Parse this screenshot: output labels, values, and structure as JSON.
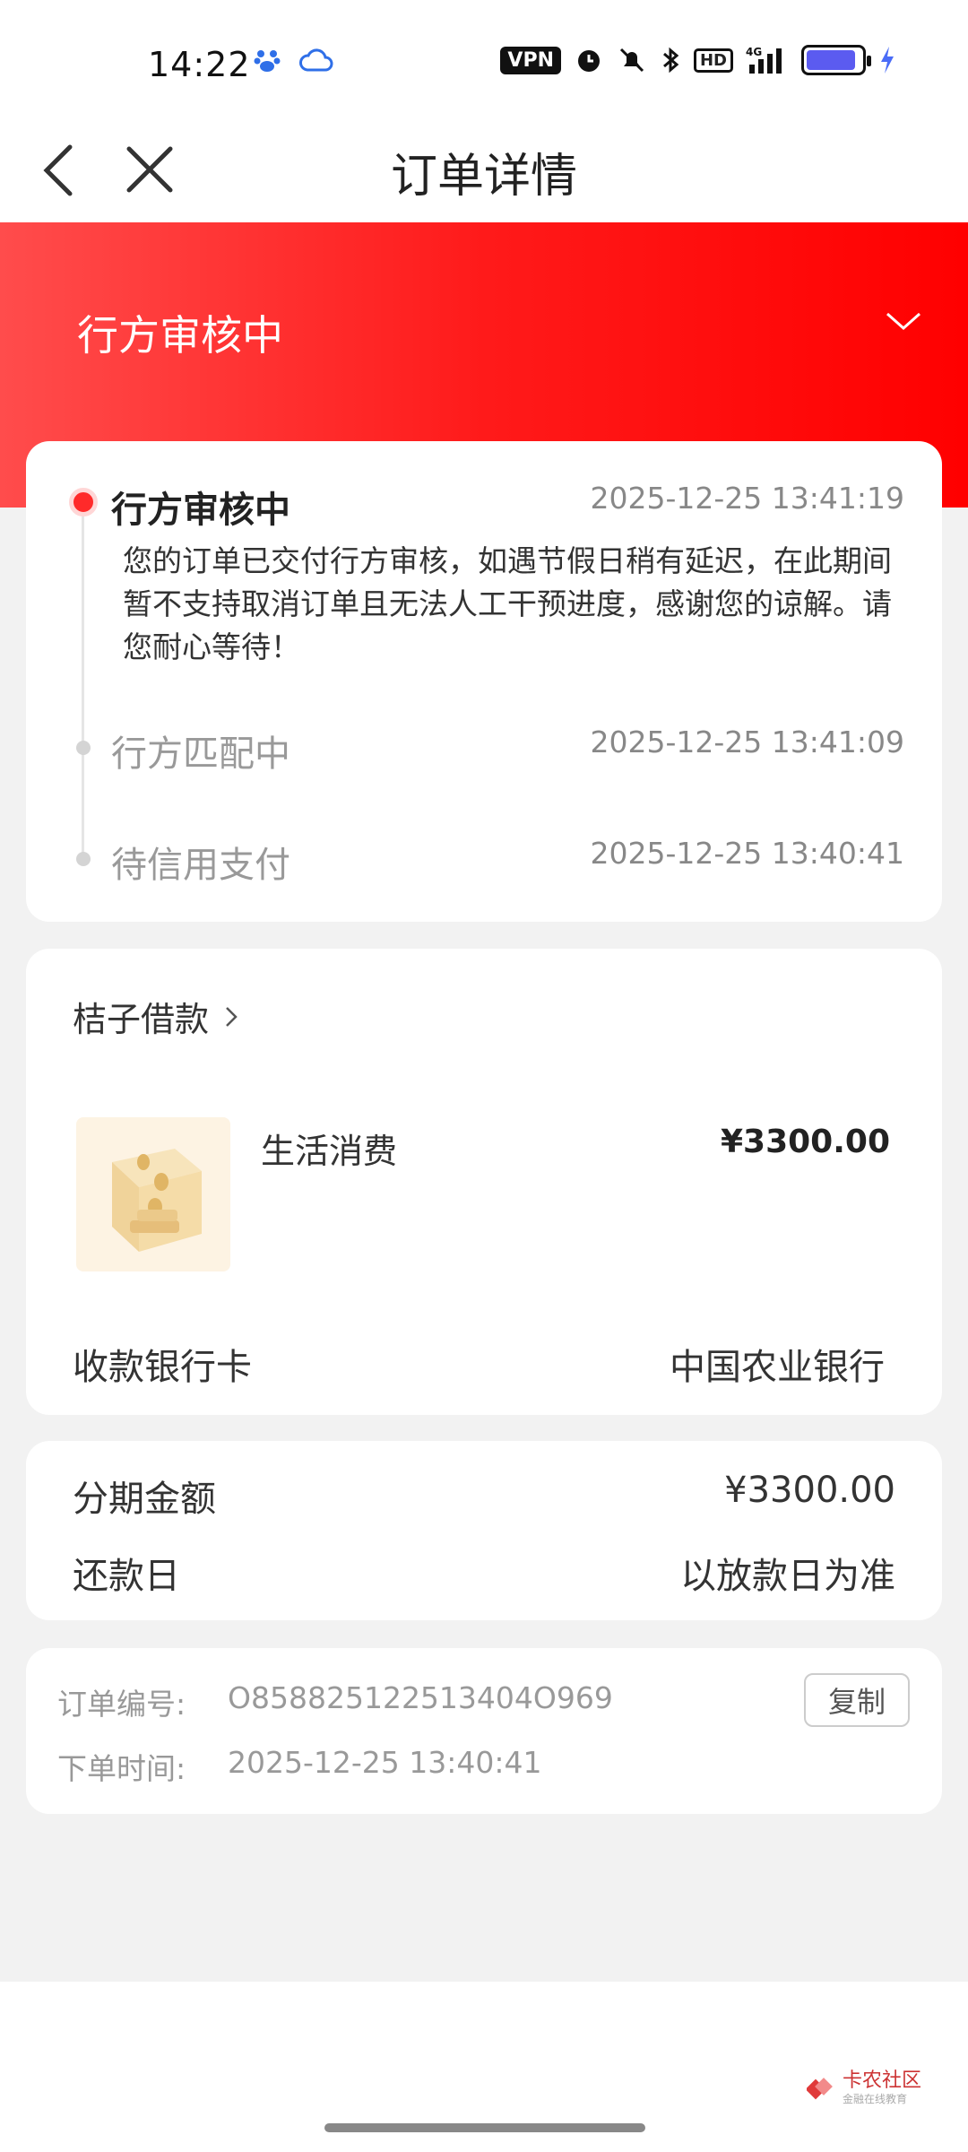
{
  "status_bar": {
    "time": "14:22",
    "vpn": "VPN",
    "hd": "HD",
    "network": "4G",
    "battery_level": 0.9,
    "icons": [
      "baidu-paw-icon",
      "weather-cloud-icon",
      "alarm-icon",
      "mute-bell-icon",
      "bluetooth-icon",
      "signal-icon",
      "charging-icon"
    ]
  },
  "nav": {
    "title": "订单详情"
  },
  "status_header": {
    "title": "行方审核中"
  },
  "timeline": [
    {
      "title": "行方审核中",
      "time": "2025-12-25 13:41:19",
      "description": "您的订单已交付行方审核，如遇节假日稍有延迟，在此期间暂不支持取消订单且无法人工干预进度，感谢您的谅解。请您耐心等待！"
    },
    {
      "title": "行方匹配中",
      "time": "2025-12-25 13:41:09"
    },
    {
      "title": "待信用支付",
      "time": "2025-12-25 13:40:41"
    }
  ],
  "product": {
    "vendor": "桔子借款",
    "name": "生活消费",
    "price": "¥3300.00",
    "bank_label": "收款银行卡",
    "bank_value": "中国农业银行"
  },
  "installment": {
    "amount_label": "分期金额",
    "amount_value": "¥3300.00",
    "repay_label": "还款日",
    "repay_value": "以放款日为准"
  },
  "order_info": {
    "number_label": "订单编号:",
    "number_value": "O858825122513404O969",
    "time_label": "下单时间:",
    "time_value": "2025-12-25 13:40:41",
    "copy_label": "复制"
  },
  "watermark": {
    "text": "卡农社区",
    "sub": "金融在线教育"
  },
  "colors": {
    "brand_red": "#ff1a1a",
    "active_dot": "#ff2a2a",
    "background": "#f2f2f2"
  }
}
